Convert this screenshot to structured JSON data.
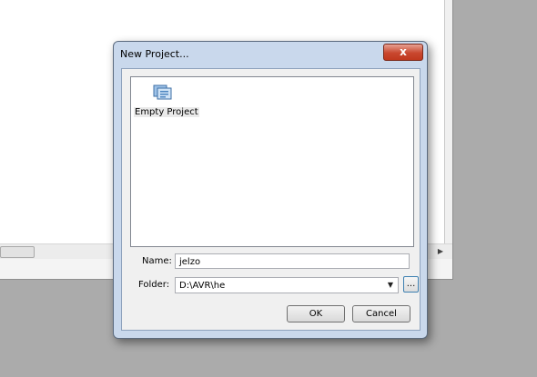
{
  "dialog": {
    "title": "New Project...",
    "close_label": "x"
  },
  "project_types": [
    {
      "label": "Empty Project",
      "icon": "empty-project-icon"
    }
  ],
  "form": {
    "name_label": "Name:",
    "name_value": "jelzo",
    "folder_label": "Folder:",
    "folder_value": "D:\\AVR\\he",
    "browse_label": "..."
  },
  "buttons": {
    "ok_label": "OK",
    "cancel_label": "Cancel"
  }
}
